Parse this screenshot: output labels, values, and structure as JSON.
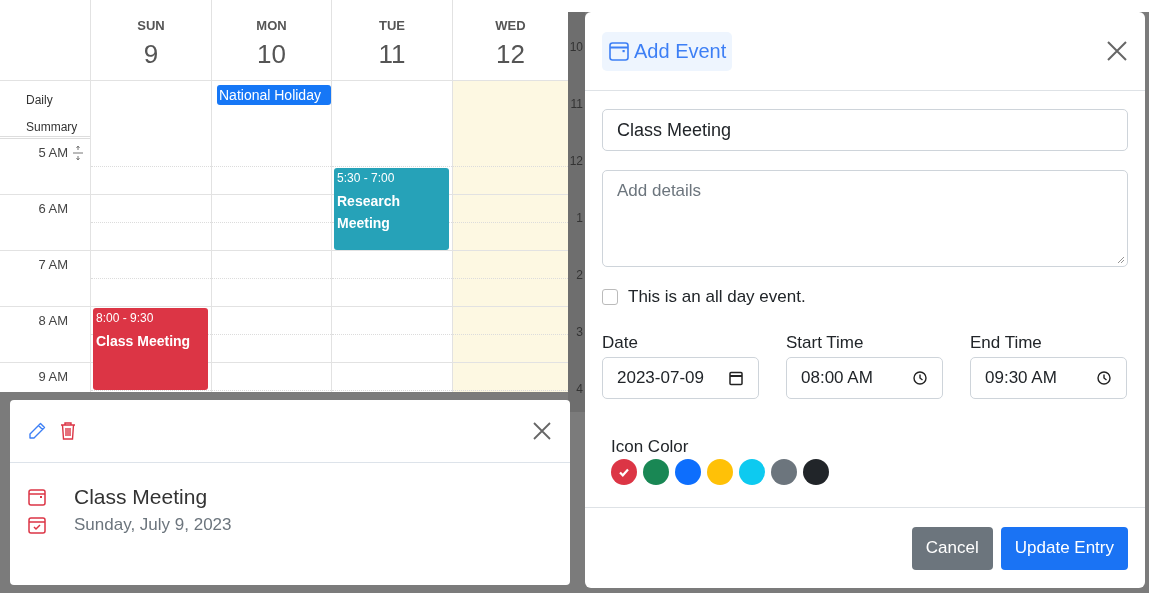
{
  "calendar": {
    "summary_label": "Daily Summary",
    "hours": [
      "5 AM",
      "6 AM",
      "7 AM",
      "8 AM",
      "9 AM"
    ],
    "days": [
      {
        "weekday": "SUN",
        "date": "9",
        "highlighted": false,
        "events": [
          {
            "time": "8:00 - 9:30",
            "title": "Class Meeting",
            "color": "#dc3545"
          }
        ]
      },
      {
        "weekday": "MON",
        "date": "10",
        "highlighted": false,
        "all_day": [
          {
            "title": "National Holiday",
            "color": "#1677f6"
          }
        ]
      },
      {
        "weekday": "TUE",
        "date": "11",
        "highlighted": false,
        "events": [
          {
            "time": "5:30 - 7:00",
            "title": "Research Meeting",
            "color": "#26a2b8"
          }
        ]
      },
      {
        "weekday": "WED",
        "date": "12",
        "highlighted": true
      }
    ],
    "background_hours": [
      "10",
      "11",
      "12",
      "1",
      "2",
      "3",
      "4"
    ]
  },
  "event_popup": {
    "title": "Class Meeting",
    "date": "Sunday, July 9, 2023"
  },
  "modal": {
    "title": "Add Event",
    "title_field": {
      "value": "Class Meeting"
    },
    "details_field": {
      "placeholder": "Add details"
    },
    "all_day": {
      "label": "This is an all day event.",
      "checked": false
    },
    "date": {
      "label": "Date",
      "value": "2023-07-09"
    },
    "start_time": {
      "label": "Start Time",
      "value": "08:00 AM"
    },
    "end_time": {
      "label": "End Time",
      "value": "09:30 AM"
    },
    "icon_color": {
      "label": "Icon Color",
      "options": [
        {
          "color": "#dc3545",
          "selected": true
        },
        {
          "color": "#198754",
          "selected": false
        },
        {
          "color": "#0d6efd",
          "selected": false
        },
        {
          "color": "#ffc107",
          "selected": false
        },
        {
          "color": "#0dcaf0",
          "selected": false
        },
        {
          "color": "#6c757d",
          "selected": false
        },
        {
          "color": "#212529",
          "selected": false
        }
      ]
    },
    "buttons": [
      {
        "label": "Cancel",
        "kind": "secondary"
      },
      {
        "label": "Update Entry",
        "kind": "primary"
      }
    ]
  }
}
